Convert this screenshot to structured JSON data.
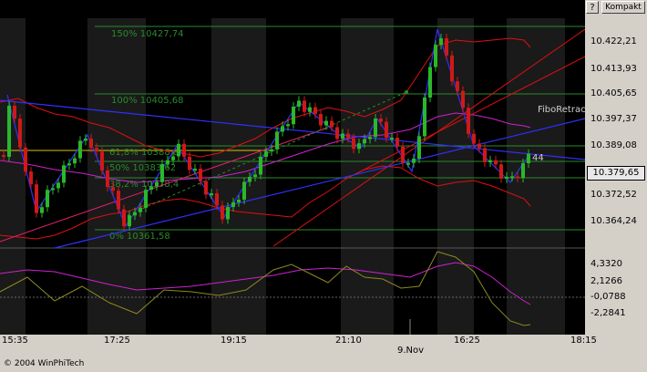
{
  "toolbar": {
    "help_label": "?",
    "compact_label": "Kompakt"
  },
  "copyright": "© 2004 WinPhiTech",
  "price_axis": {
    "ticks": [
      "10.422,21",
      "10.413,93",
      "10.405,65",
      "10.397,37",
      "10.389,08",
      "10.372,52",
      "10.364,24"
    ],
    "current_price": "10.379,65",
    "indicator_ticks": [
      "4,3320",
      "2,1266",
      "-0,0788",
      "-2,2841"
    ]
  },
  "time_axis": {
    "ticks": [
      "15:35",
      "17:25",
      "19:15",
      "21:10",
      "16:25",
      "18:15"
    ],
    "date_label": "9.Nov"
  },
  "fibonacci": {
    "levels": [
      {
        "label": "150% 10427,74"
      },
      {
        "label": "100% 10405,68"
      },
      {
        "label": "61,8% 10388,8"
      },
      {
        "label": "50% 10383,62"
      },
      {
        "label": "38,2% 10378,4"
      },
      {
        "label": "0% 10361,58"
      }
    ],
    "tool_label": "FiboRetrace",
    "count_label": "44"
  },
  "colors": {
    "background": "#000000",
    "fib_line": "#2a8a2a",
    "trendline": "#3030ff",
    "band": "#e01010"
  }
}
